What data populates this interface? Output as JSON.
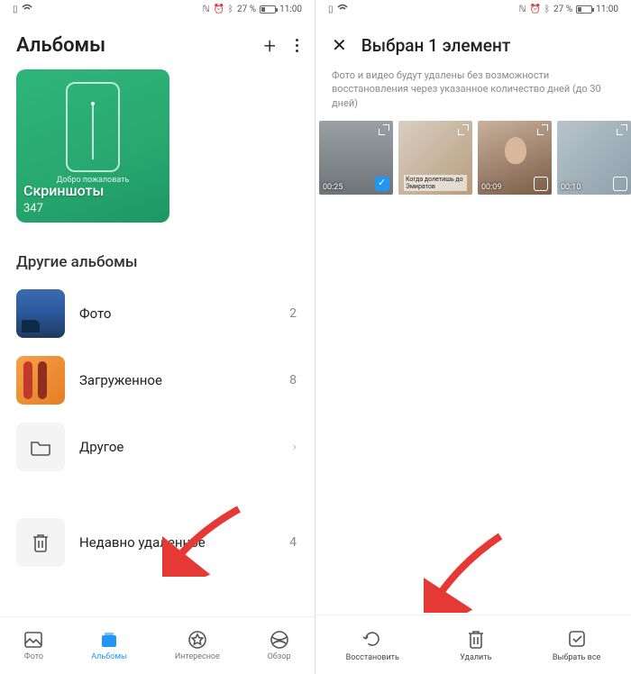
{
  "status": {
    "nfc": "NFC",
    "battery_pct": "27 %",
    "time": "11:00"
  },
  "left": {
    "title": "Альбомы",
    "card": {
      "welcome": "Добро пожаловать",
      "name": "Скриншоты",
      "count": "347"
    },
    "section": "Другие альбомы",
    "rows": {
      "photo": {
        "label": "Фото",
        "count": "2"
      },
      "dl": {
        "label": "Загруженное",
        "count": "8"
      },
      "other": {
        "label": "Другое",
        "count": ""
      },
      "trash": {
        "label": "Недавно удаленное",
        "count": "4"
      }
    },
    "nav": {
      "photo": "Фото",
      "albums": "Альбомы",
      "discover": "Интересное",
      "browse": "Обзор"
    }
  },
  "right": {
    "title": "Выбран 1 элемент",
    "info": "Фото и видео будут удалены без возможности восстановления через указанное количество дней (до 30 дней)",
    "thumbs": [
      {
        "dur": "00:25"
      },
      {
        "dur": ""
      },
      {
        "dur": "00:09"
      },
      {
        "dur": "00:10"
      }
    ],
    "actions": {
      "restore": "Восстановить",
      "delete": "Удалить",
      "selectall": "Выбрать все"
    }
  }
}
